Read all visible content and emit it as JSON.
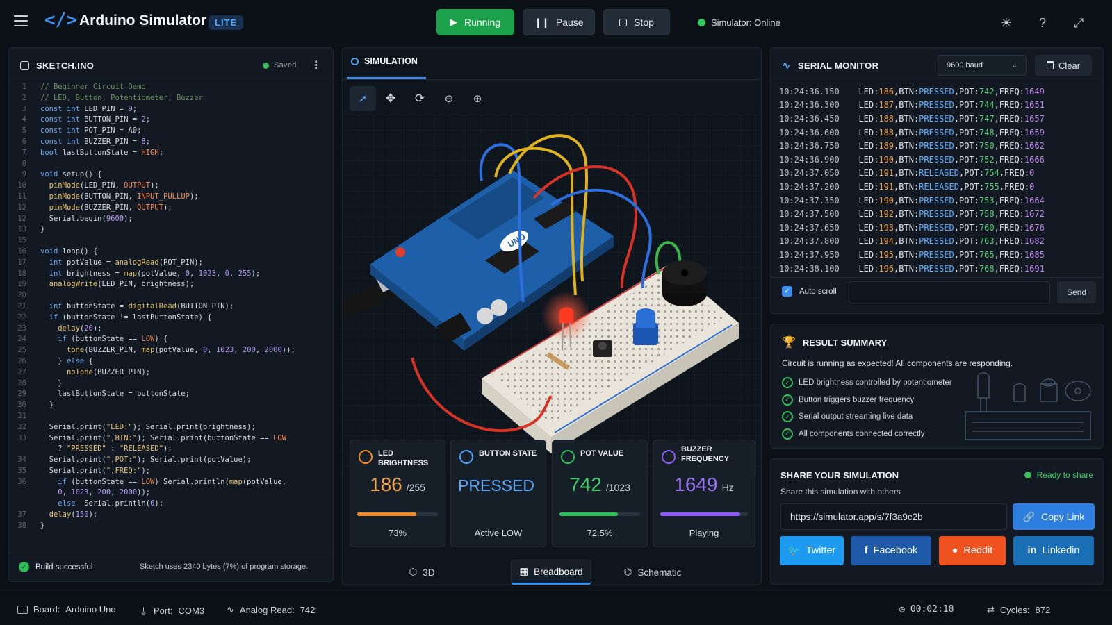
{
  "header": {
    "app_title": "Arduino Simulator",
    "badge": "LITE",
    "run_label": "Running",
    "pause_label": "Pause",
    "stop_label": "Stop",
    "status_text": "Simulator: Online",
    "status_color": "#2ec95b"
  },
  "sketch": {
    "title": "SKETCH.INO",
    "saved_label": "Saved",
    "lines": [
      {
        "n": "1",
        "t": "// Beginner Circuit Demo",
        "c": "cm"
      },
      {
        "n": "2",
        "t": "// LED, Button, Potentiometer, Buzzer",
        "c": "cm"
      },
      {
        "n": "3",
        "t": "const int LED_PIN = 9;",
        "c": "ct"
      },
      {
        "n": "4",
        "t": "const int BUTTON_PIN = 2;",
        "c": "ct"
      },
      {
        "n": "5",
        "t": "const int POT_PIN = A0;",
        "c": "ct"
      },
      {
        "n": "6",
        "t": "const int BUZZER_PIN = 8;",
        "c": "ct"
      },
      {
        "n": "7",
        "t": "bool lastButtonState = HIGH;",
        "c": "ct"
      },
      {
        "n": "8",
        "t": "",
        "c": "ct"
      },
      {
        "n": "9",
        "t": "void setup() {",
        "c": "ct"
      },
      {
        "n": "10",
        "t": "  pinMode(LED_PIN, OUTPUT);",
        "c": "ct"
      },
      {
        "n": "11",
        "t": "  pinMode(BUTTON_PIN, INPUT_PULLUP);",
        "c": "ct"
      },
      {
        "n": "12",
        "t": "  pinMode(BUZZER_PIN, OUTPUT);",
        "c": "ct"
      },
      {
        "n": "12",
        "t": "  Serial.begin(9600);",
        "c": "ct"
      },
      {
        "n": "13",
        "t": "}",
        "c": "ct"
      },
      {
        "n": "15",
        "t": "",
        "c": "ct"
      },
      {
        "n": "16",
        "t": "void loop() {",
        "c": "ct"
      },
      {
        "n": "17",
        "t": "  int potValue = analogRead(POT_PIN);",
        "c": "ct"
      },
      {
        "n": "18",
        "t": "  int brightness = map(potValue, 0, 1023, 0, 255);",
        "c": "ct"
      },
      {
        "n": "19",
        "t": "  analogWrite(LED_PIN, brightness);",
        "c": "ct"
      },
      {
        "n": "20",
        "t": "",
        "c": "ct"
      },
      {
        "n": "21",
        "t": "  int buttonState = digitalRead(BUTTON_PIN);",
        "c": "ct"
      },
      {
        "n": "22",
        "t": "  if (buttonState != lastButtonState) {",
        "c": "ct"
      },
      {
        "n": "23",
        "t": "    delay(20);",
        "c": "ct"
      },
      {
        "n": "24",
        "t": "    if (buttonState == LOW) {",
        "c": "ct"
      },
      {
        "n": "25",
        "t": "      tone(BUZZER_PIN, map(potValue, 0, 1023, 200, 2000));",
        "c": "ct"
      },
      {
        "n": "26",
        "t": "    } else {",
        "c": "ct"
      },
      {
        "n": "27",
        "t": "      noTone(BUZZER_PIN);",
        "c": "ct"
      },
      {
        "n": "28",
        "t": "    }",
        "c": "ct"
      },
      {
        "n": "29",
        "t": "    lastButtonState = buttonState;",
        "c": "ct"
      },
      {
        "n": "30",
        "t": "  }",
        "c": "ct"
      },
      {
        "n": "31",
        "t": "",
        "c": "ct"
      },
      {
        "n": "32",
        "t": "  Serial.print(\"LED:\"); Serial.print(brightness);",
        "c": "ct"
      },
      {
        "n": "33",
        "t": "  Serial.print(\",BTN:\"); Serial.print(buttonState == LOW",
        "c": "ct"
      },
      {
        "n": "",
        "t": "    ? \"PRESSED\" : \"RELEASED\");",
        "c": "ct"
      },
      {
        "n": "34",
        "t": "  Serial.print(\",POT:\"); Serial.print(potValue);",
        "c": "ct"
      },
      {
        "n": "35",
        "t": "  Serial.print(\",FREQ:\");",
        "c": "ct"
      },
      {
        "n": "36",
        "t": "    if (buttonState == LOW) Serial.println(map(potValue,",
        "c": "ct"
      },
      {
        "n": "",
        "t": "    0, 1023, 200, 2000));",
        "c": "ct"
      },
      {
        "n": "",
        "t": "    else  Serial.println(0);",
        "c": "ct"
      },
      {
        "n": "37",
        "t": "  delay(150);",
        "c": "ct"
      },
      {
        "n": "38",
        "t": "}",
        "c": "ct"
      }
    ],
    "build_status": "Build successful",
    "build_info": "Sketch uses 2340 bytes (7%) of program storage."
  },
  "simulation": {
    "tab_label": "SIMULATION",
    "view_tabs": [
      "3D",
      "Breadboard",
      "Schematic"
    ],
    "board_label": "UNO"
  },
  "cards": [
    {
      "label": "LED BRIGHTNESS",
      "value": "186",
      "unit": "/255",
      "sub": "73%",
      "fill": 0.73,
      "color": "#f08a2c",
      "valcolor": "#f5a04a",
      "icon": "sun-icon"
    },
    {
      "label": "BUTTON STATE",
      "value": "PRESSED",
      "unit": "",
      "sub": "Active LOW",
      "fill": 0,
      "color": "#4fa3f5",
      "valcolor": "#5aa8f5",
      "icon": "hand-pointer-icon"
    },
    {
      "label": "POT VALUE",
      "value": "742",
      "unit": "/1023",
      "sub": "72.5%",
      "fill": 0.725,
      "color": "#2fbf5a",
      "valcolor": "#3fd06a",
      "icon": "gauge-icon"
    },
    {
      "label": "BUZZER FREQUENCY",
      "value": "1649",
      "unit": "Hz",
      "sub": "Playing",
      "fill": 0.91,
      "color": "#8a5cf5",
      "valcolor": "#9a72f5",
      "icon": "waveform-icon"
    }
  ],
  "serial": {
    "title": "SERIAL MONITOR",
    "baud": "9600 baud",
    "clear_label": "Clear",
    "autoscroll_label": "Auto scroll",
    "send_label": "Send",
    "lines": [
      {
        "ts": "10:24:36.150",
        "led": "186",
        "btn": "PRESSED",
        "pot": "742",
        "freq": "1649"
      },
      {
        "ts": "10:24:36.300",
        "led": "187",
        "btn": "PRESSED",
        "pot": "744",
        "freq": "1651"
      },
      {
        "ts": "10:24:36.450",
        "led": "188",
        "btn": "PRESSED",
        "pot": "747",
        "freq": "1657"
      },
      {
        "ts": "10:24:36.600",
        "led": "188",
        "btn": "PRESSED",
        "pot": "748",
        "freq": "1659"
      },
      {
        "ts": "10:24:36.750",
        "led": "189",
        "btn": "PRESSED",
        "pot": "750",
        "freq": "1662"
      },
      {
        "ts": "10:24:36.900",
        "led": "190",
        "btn": "PRESSED",
        "pot": "752",
        "freq": "1666"
      },
      {
        "ts": "10:24:37.050",
        "led": "191",
        "btn": "RELEASED",
        "pot": "754",
        "freq": "0"
      },
      {
        "ts": "10:24:37.200",
        "led": "191",
        "btn": "RELEASED",
        "pot": "755",
        "freq": "0"
      },
      {
        "ts": "10:24:37.350",
        "led": "190",
        "btn": "PRESSED",
        "pot": "753",
        "freq": "1664"
      },
      {
        "ts": "10:24:37.500",
        "led": "192",
        "btn": "PRESSED",
        "pot": "758",
        "freq": "1672"
      },
      {
        "ts": "10:24:37.650",
        "led": "193",
        "btn": "PRESSED",
        "pot": "760",
        "freq": "1676"
      },
      {
        "ts": "10:24:37.800",
        "led": "194",
        "btn": "PRESSED",
        "pot": "763",
        "freq": "1682"
      },
      {
        "ts": "10:24:37.950",
        "led": "195",
        "btn": "PRESSED",
        "pot": "765",
        "freq": "1685"
      },
      {
        "ts": "10:24:38.100",
        "led": "196",
        "btn": "PRESSED",
        "pot": "768",
        "freq": "1691"
      }
    ]
  },
  "result": {
    "title": "RESULT SUMMARY",
    "summary": "Circuit is running as expected! All components are responding.",
    "checks": [
      "LED brightness controlled by potentiometer",
      "Button triggers buzzer frequency",
      "Serial output streaming live data",
      "All components connected correctly"
    ]
  },
  "share": {
    "title": "SHARE YOUR SIMULATION",
    "status": "Ready to share",
    "subtitle": "Share this simulation with others",
    "url": "https://simulator.app/s/7f3a9c2b",
    "copy_label": "Copy Link",
    "buttons": [
      {
        "label": "Twitter",
        "color": "#1d9bf0",
        "icon": "twitter-icon"
      },
      {
        "label": "Facebook",
        "color": "#1f5aa8",
        "icon": "facebook-icon"
      },
      {
        "label": "Reddit",
        "color": "#f0521f",
        "icon": "reddit-icon"
      },
      {
        "label": "Linkedin",
        "color": "#1a6fb5",
        "icon": "linkedin-icon"
      }
    ]
  },
  "footer": {
    "board_label": "Board:",
    "board_value": "Arduino Uno",
    "port_label": "Port:",
    "port_value": "COM3",
    "analog_label": "Analog Read:",
    "analog_value": "742",
    "timer": "00:02:18",
    "cycles_label": "Cycles:",
    "cycles_value": "872"
  }
}
